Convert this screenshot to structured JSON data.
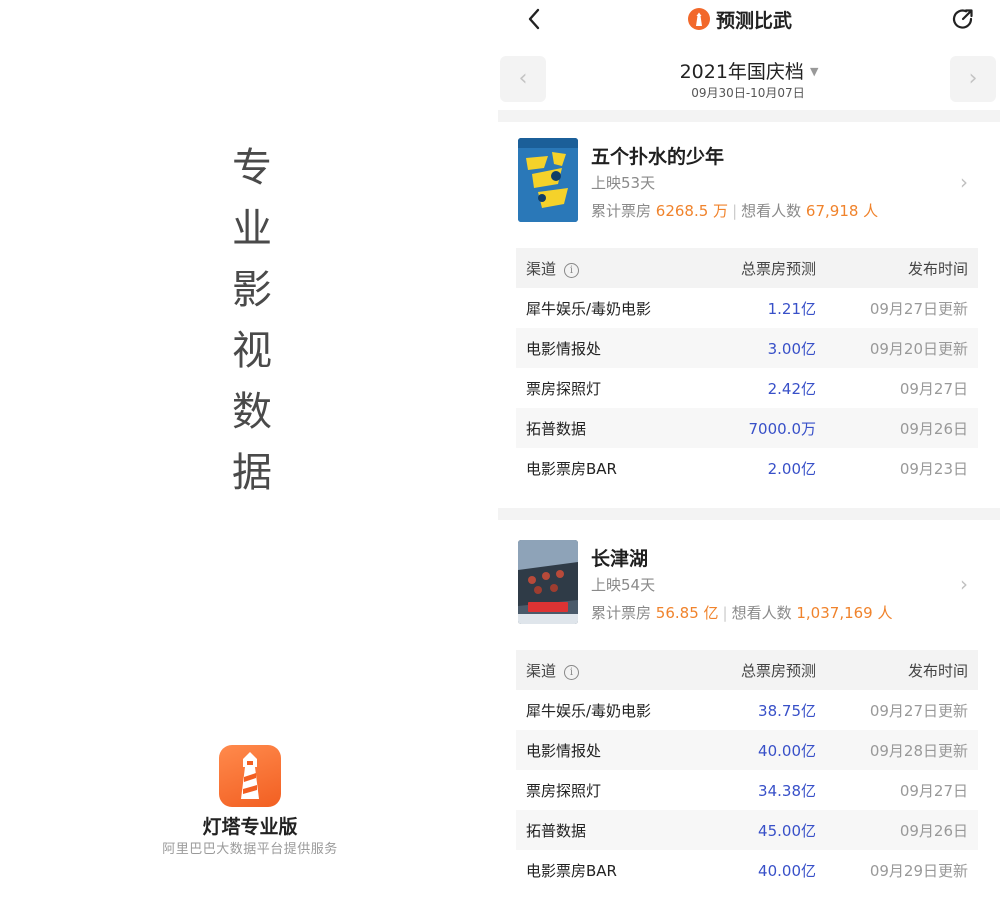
{
  "splash": {
    "slogan": [
      "专",
      "业",
      "影",
      "视",
      "数",
      "据"
    ],
    "app_name": "灯塔专业版",
    "provider": "阿里巴巴大数据平台提供服务"
  },
  "nav": {
    "back_icon": "chevron-left-icon",
    "title": "预测比武",
    "share_icon": "share-icon"
  },
  "period": {
    "title": "2021年国庆档",
    "dates": "09月30日-10月07日",
    "prev_icon": "‹",
    "next_icon": "›"
  },
  "table_headers": {
    "channel": "渠道",
    "forecast": "总票房预测",
    "time": "发布时间"
  },
  "movies": [
    {
      "title": "五个扑水的少年",
      "days": "上映53天",
      "box_label": "累计票房",
      "box_value": "6268.5 万",
      "want_label": "想看人数",
      "want_value": "67,918 人",
      "rows": [
        {
          "channel": "犀牛娱乐/毒奶电影",
          "forecast": "1.21亿",
          "time": "09月27日更新"
        },
        {
          "channel": "电影情报处",
          "forecast": "3.00亿",
          "time": "09月20日更新"
        },
        {
          "channel": "票房探照灯",
          "forecast": "2.42亿",
          "time": "09月27日"
        },
        {
          "channel": "拓普数据",
          "forecast": "7000.0万",
          "time": "09月26日"
        },
        {
          "channel": "电影票房BAR",
          "forecast": "2.00亿",
          "time": "09月23日"
        }
      ]
    },
    {
      "title": "长津湖",
      "days": "上映54天",
      "box_label": "累计票房",
      "box_value": "56.85 亿",
      "want_label": "想看人数",
      "want_value": "1,037,169 人",
      "rows": [
        {
          "channel": "犀牛娱乐/毒奶电影",
          "forecast": "38.75亿",
          "time": "09月27日更新"
        },
        {
          "channel": "电影情报处",
          "forecast": "40.00亿",
          "time": "09月28日更新"
        },
        {
          "channel": "票房探照灯",
          "forecast": "34.38亿",
          "time": "09月27日"
        },
        {
          "channel": "拓普数据",
          "forecast": "45.00亿",
          "time": "09月26日"
        },
        {
          "channel": "电影票房BAR",
          "forecast": "40.00亿",
          "time": "09月29日更新"
        }
      ]
    }
  ],
  "colors": {
    "accent_orange": "#f0832c",
    "forecast_blue": "#3850c8",
    "brand_orange": "#f25f22"
  }
}
